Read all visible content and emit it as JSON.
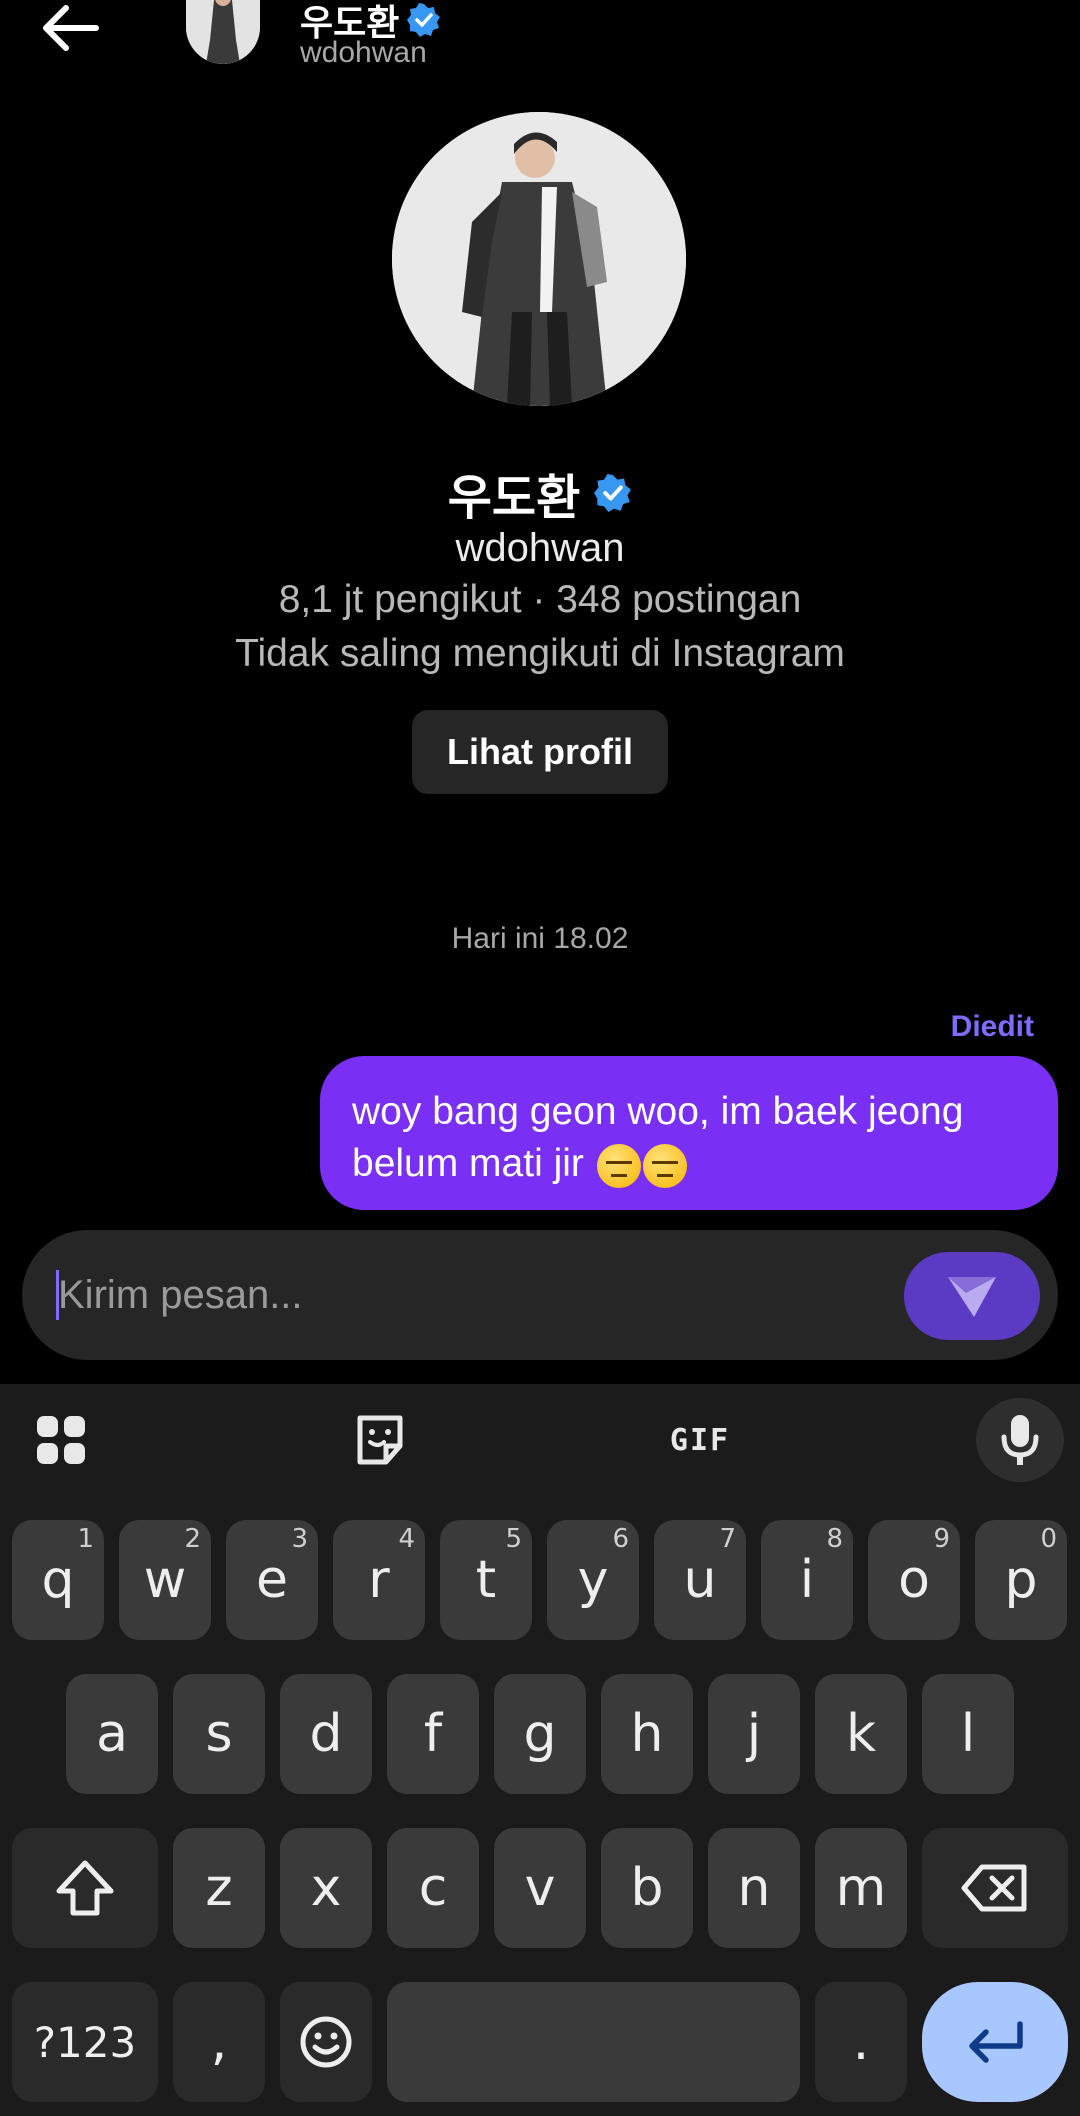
{
  "header": {
    "name": "우도환",
    "username": "wdohwan"
  },
  "profile": {
    "name": "우도환",
    "username": "wdohwan",
    "stats": "8,1 jt pengikut · 348 postingan",
    "mutual": "Tidak saling mengikuti di Instagram",
    "view_profile_label": "Lihat profil"
  },
  "conversation": {
    "timestamp": "Hari ini 18.02",
    "edited_label": "Diedit",
    "messages": [
      {
        "from": "me",
        "text": "woy bang geon woo, im baek jeong belum mati jir",
        "emojis": [
          "downcast-face-with-sweat",
          "downcast-face-with-sweat"
        ]
      }
    ]
  },
  "composer": {
    "placeholder": "Kirim pesan..."
  },
  "keyboard": {
    "toolbar": {
      "gif_label": "GIF"
    },
    "row1": [
      {
        "key": "q",
        "hint": "1"
      },
      {
        "key": "w",
        "hint": "2"
      },
      {
        "key": "e",
        "hint": "3"
      },
      {
        "key": "r",
        "hint": "4"
      },
      {
        "key": "t",
        "hint": "5"
      },
      {
        "key": "y",
        "hint": "6"
      },
      {
        "key": "u",
        "hint": "7"
      },
      {
        "key": "i",
        "hint": "8"
      },
      {
        "key": "o",
        "hint": "9"
      },
      {
        "key": "p",
        "hint": "0"
      }
    ],
    "row2": [
      "a",
      "s",
      "d",
      "f",
      "g",
      "h",
      "j",
      "k",
      "l"
    ],
    "row3": [
      "z",
      "x",
      "c",
      "v",
      "b",
      "n",
      "m"
    ],
    "symbols_label": "?123",
    "comma": ",",
    "period": "."
  },
  "colors": {
    "accent": "#7e6cff",
    "bubble": "#7a2ff5",
    "verified": "#3897f0",
    "enter_key": "#a9c7ff"
  }
}
